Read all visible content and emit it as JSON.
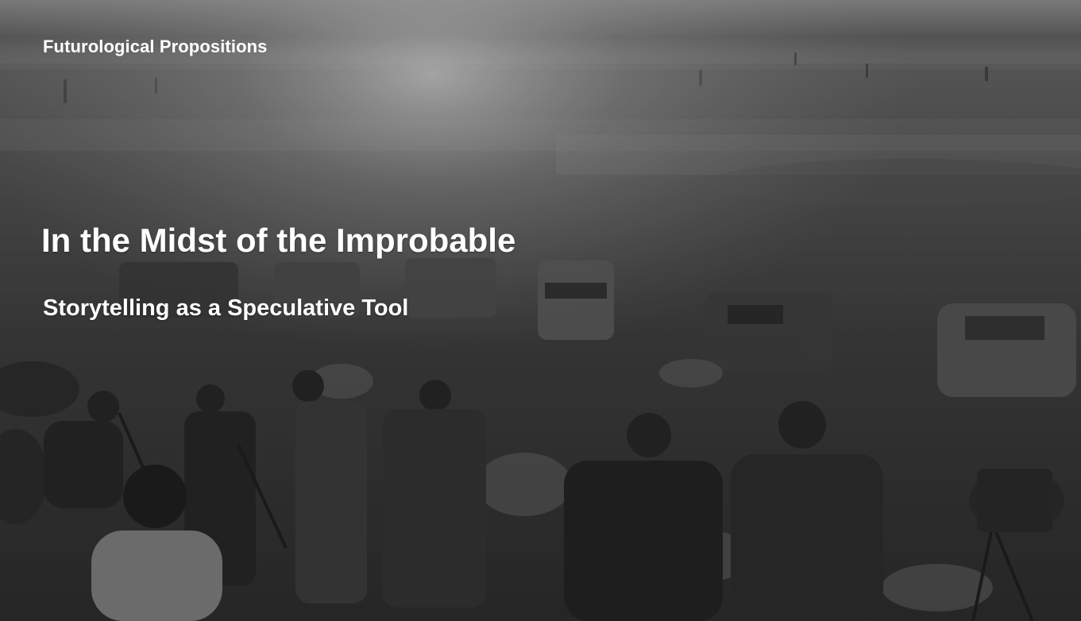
{
  "slide": {
    "kicker": "Futurological Propositions",
    "title": "In the Midst of the Improbable",
    "subtitle": "Storytelling as a Speculative Tool"
  },
  "background": {
    "description_icon": "desert-photograph-icon",
    "tone": "#6e6e6e"
  }
}
